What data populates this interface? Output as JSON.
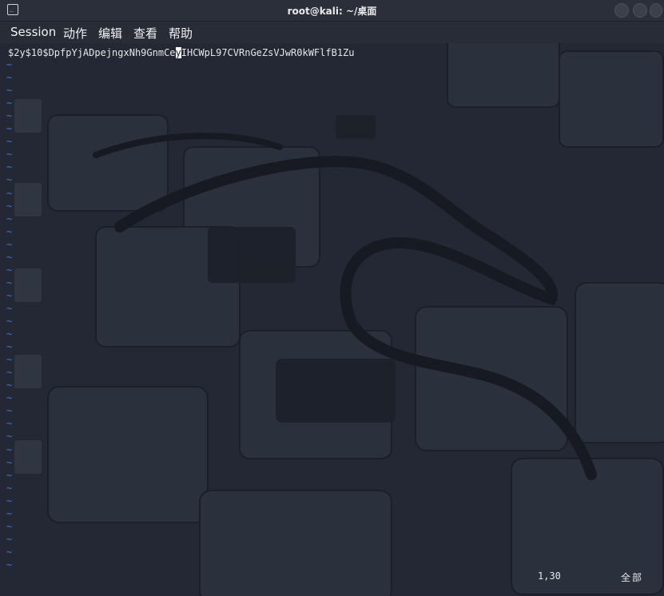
{
  "window": {
    "title": "root@kali: ~/桌面",
    "app_icon_glyph": "_"
  },
  "menu": {
    "items": [
      "Session",
      "动作",
      "编辑",
      "查看",
      "帮助"
    ]
  },
  "editor": {
    "line_before_cursor": "$2y$10$DpfpYjADpejngxNh9GnmCe",
    "cursor_char": "y",
    "line_after_cursor": "IHCWpL97CVRnGeZsVJwR0kWFlfB1Zu",
    "tilde_char": "~",
    "status_position": "1,30",
    "status_extent": "全部"
  },
  "colors": {
    "tilde": "#3a79c9",
    "text": "#e6e6e6",
    "background": "#232834"
  }
}
